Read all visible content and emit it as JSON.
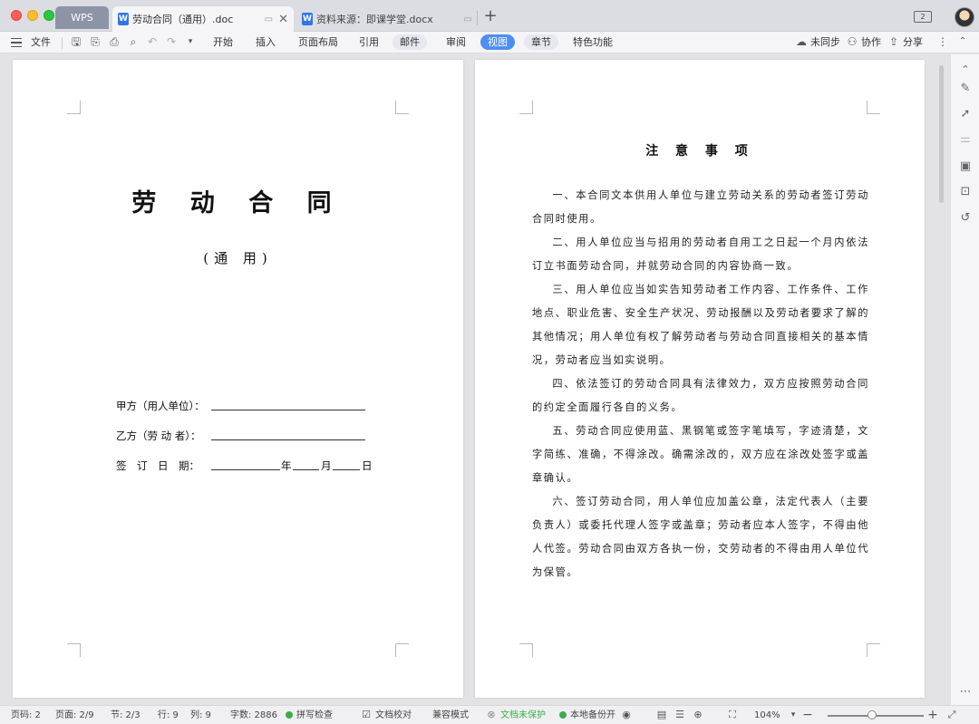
{
  "tabs": {
    "wps_label": "WPS",
    "active_doc": "劳动合同（通用）.doc",
    "inactive_doc": "资料来源：即课学堂.docx",
    "window_count": "2"
  },
  "ribbon": {
    "file": "文件",
    "items": [
      "开始",
      "插入",
      "页面布局",
      "引用",
      "邮件",
      "审阅",
      "视图",
      "章节",
      "特色功能"
    ],
    "sync": "未同步",
    "collab": "协作",
    "share": "分享"
  },
  "left_page": {
    "title": "劳 动 合 同",
    "subtitle": "(通 用)",
    "party_a": "甲方（用人单位）：",
    "party_b": "乙方（劳 动 者）：",
    "sign_date": "签　订　日　期：",
    "year": "年",
    "month": "月",
    "day": "日"
  },
  "right_page": {
    "title": "注 意 事 项",
    "paragraphs": [
      "一、本合同文本供用人单位与建立劳动关系的劳动者签订劳动合同时使用。",
      "二、用人单位应当与招用的劳动者自用工之日起一个月内依法订立书面劳动合同，并就劳动合同的内容协商一致。",
      "三、用人单位应当如实告知劳动者工作内容、工作条件、工作地点、职业危害、安全生产状况、劳动报酬以及劳动者要求了解的其他情况；用人单位有权了解劳动者与劳动合同直接相关的基本情况，劳动者应当如实说明。",
      "四、依法签订的劳动合同具有法律效力，双方应按照劳动合同的约定全面履行各自的义务。",
      "五、劳动合同应使用蓝、黑钢笔或签字笔填写，字迹清楚，文字简练、准确，不得涂改。确需涂改的，双方应在涂改处签字或盖章确认。",
      "六、签订劳动合同，用人单位应加盖公章，法定代表人（主要负责人）或委托代理人签字或盖章；劳动者应本人签字，不得由他人代签。劳动合同由双方各执一份，交劳动者的不得由用人单位代为保管。"
    ]
  },
  "status": {
    "page_num": "页码: 2",
    "pages": "页面: 2/9",
    "section": "节: 2/3",
    "row": "行: 9",
    "col": "列: 9",
    "word_count": "字数: 2886",
    "spell_check": "拼写检查",
    "doc_proof": "文档校对",
    "compat_mode": "兼容模式",
    "unprotected": "文档未保护",
    "local_backup": "本地备份开",
    "zoom": "104%",
    "zoom_level_fraction": 0.52
  }
}
